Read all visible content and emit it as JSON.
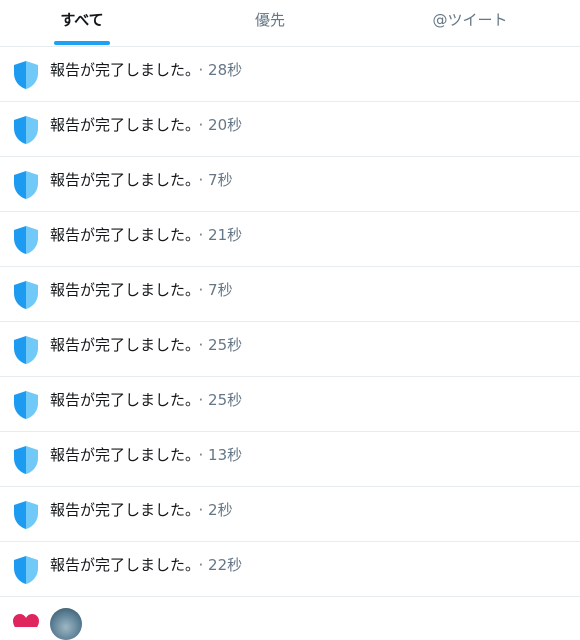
{
  "tabs": [
    {
      "label": "すべて",
      "active": true
    },
    {
      "label": "優先",
      "active": false
    },
    {
      "label": "@ツイート",
      "active": false
    }
  ],
  "accent_color": "#1da1f2",
  "notifications": [
    {
      "icon": "shield-icon",
      "text": "報告が完了しました。",
      "time": "· 28秒"
    },
    {
      "icon": "shield-icon",
      "text": "報告が完了しました。",
      "time": "· 20秒"
    },
    {
      "icon": "shield-icon",
      "text": "報告が完了しました。",
      "time": "· 7秒"
    },
    {
      "icon": "shield-icon",
      "text": "報告が完了しました。",
      "time": "· 21秒"
    },
    {
      "icon": "shield-icon",
      "text": "報告が完了しました。",
      "time": "· 7秒"
    },
    {
      "icon": "shield-icon",
      "text": "報告が完了しました。",
      "time": "· 25秒"
    },
    {
      "icon": "shield-icon",
      "text": "報告が完了しました。",
      "time": "· 25秒"
    },
    {
      "icon": "shield-icon",
      "text": "報告が完了しました。",
      "time": "· 13秒"
    },
    {
      "icon": "shield-icon",
      "text": "報告が完了しました。",
      "time": "· 2秒"
    },
    {
      "icon": "shield-icon",
      "text": "報告が完了しました。",
      "time": "· 22秒"
    }
  ],
  "partial_row": {
    "icon": "heart-icon",
    "avatar": "avatar"
  }
}
